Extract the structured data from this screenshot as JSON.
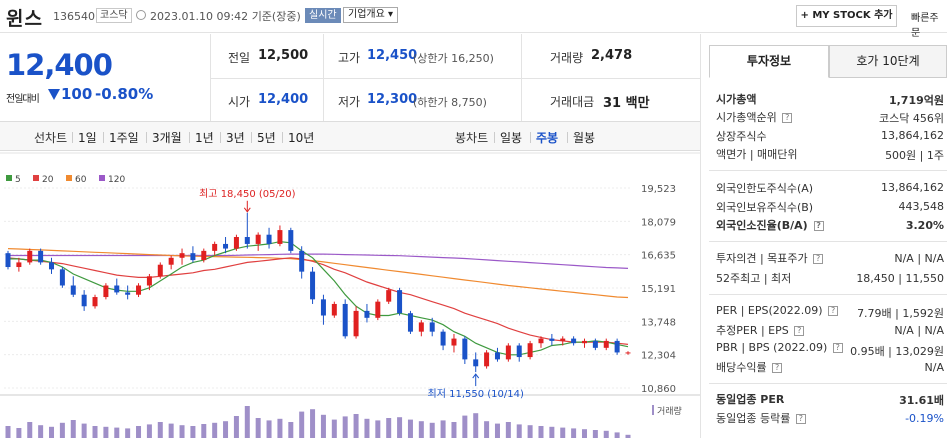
{
  "header": {
    "name": "윈스",
    "code": "136540",
    "market": "코스닥",
    "datetime": "2023.01.10 09:42",
    "basis": "기준(장중)",
    "realtime_badge": "실시간",
    "company_overview": "기업개요",
    "mystock_button": "+ MY STOCK 추가",
    "quick_order": "빠른주문"
  },
  "quote": {
    "price": "12,400",
    "change_label": "전일대비",
    "change": "100",
    "change_pct": "-0.80%"
  },
  "stats": {
    "prev_close_label": "전일",
    "prev_close": "12,500",
    "high_label": "고가",
    "high": "12,450",
    "upper_limit": "(상한가 16,250)",
    "volume_label": "거래량",
    "volume": "2,478",
    "open_label": "시가",
    "open": "12,400",
    "low_label": "저가",
    "low": "12,300",
    "lower_limit": "(하한가 8,750)",
    "amount_label": "거래대금",
    "amount": "31 백만"
  },
  "periods": {
    "line_label": "선차트",
    "items": [
      "1일",
      "1주일",
      "3개월",
      "1년",
      "3년",
      "5년",
      "10년"
    ],
    "candle_label": "봉차트",
    "candle_items": [
      "일봉",
      "주봉",
      "월봉"
    ],
    "candle_active": "주봉"
  },
  "chart_data": {
    "type": "candlestick",
    "ma_legend": [
      {
        "name": "5",
        "color": "#3f9a3f"
      },
      {
        "name": "20",
        "color": "#e04040"
      },
      {
        "name": "60",
        "color": "#f08a30"
      },
      {
        "name": "120",
        "color": "#9b59c8"
      }
    ],
    "y_ticks": [
      "19,523",
      "18,079",
      "16,635",
      "15,191",
      "13,748",
      "12,304",
      "10,860"
    ],
    "ylim": [
      10860,
      19523
    ],
    "high_annotation": "최고 18,450 (05/20)",
    "low_annotation": "최저 11,550 (10/14)",
    "volume_label": "거래량",
    "candles": [
      [
        16700,
        16800,
        16000,
        16100
      ],
      [
        16100,
        16500,
        15900,
        16300
      ],
      [
        16300,
        16900,
        16200,
        16800
      ],
      [
        16800,
        16900,
        16200,
        16300
      ],
      [
        16300,
        16500,
        15800,
        16000
      ],
      [
        16000,
        16100,
        15200,
        15300
      ],
      [
        15300,
        15700,
        14800,
        14900
      ],
      [
        14900,
        15100,
        14200,
        14400
      ],
      [
        14400,
        14900,
        14300,
        14800
      ],
      [
        14800,
        15400,
        14700,
        15300
      ],
      [
        15300,
        15600,
        14900,
        15000
      ],
      [
        15000,
        15300,
        14700,
        14900
      ],
      [
        14900,
        15400,
        14800,
        15300
      ],
      [
        15300,
        15800,
        15100,
        15700
      ],
      [
        15700,
        16300,
        15600,
        16200
      ],
      [
        16200,
        16600,
        16000,
        16500
      ],
      [
        16500,
        16900,
        16200,
        16700
      ],
      [
        16700,
        17000,
        16300,
        16400
      ],
      [
        16400,
        16900,
        16300,
        16800
      ],
      [
        16800,
        17200,
        16600,
        17100
      ],
      [
        17100,
        17400,
        16700,
        16900
      ],
      [
        16900,
        17500,
        16800,
        17400
      ],
      [
        17400,
        18450,
        16900,
        17100
      ],
      [
        17100,
        17600,
        16800,
        17500
      ],
      [
        17500,
        17800,
        16900,
        17100
      ],
      [
        17100,
        17900,
        17000,
        17700
      ],
      [
        17700,
        17800,
        16700,
        16800
      ],
      [
        16800,
        17000,
        15600,
        15900
      ],
      [
        15900,
        16100,
        14500,
        14700
      ],
      [
        14700,
        14900,
        13600,
        14000
      ],
      [
        14000,
        14600,
        13900,
        14500
      ],
      [
        14500,
        14700,
        13000,
        13100
      ],
      [
        13100,
        14400,
        13000,
        14200
      ],
      [
        14200,
        14500,
        13700,
        13900
      ],
      [
        13900,
        14700,
        13800,
        14600
      ],
      [
        14600,
        15200,
        14500,
        15100
      ],
      [
        15100,
        15200,
        14000,
        14100
      ],
      [
        14100,
        14200,
        13200,
        13300
      ],
      [
        13300,
        13800,
        13100,
        13700
      ],
      [
        13700,
        13900,
        13100,
        13300
      ],
      [
        13300,
        13400,
        12500,
        12700
      ],
      [
        12700,
        13200,
        12400,
        13000
      ],
      [
        13000,
        13100,
        11900,
        12100
      ],
      [
        12100,
        12400,
        11550,
        11800
      ],
      [
        11800,
        12500,
        11700,
        12400
      ],
      [
        12400,
        12600,
        12000,
        12100
      ],
      [
        12100,
        12800,
        12000,
        12700
      ],
      [
        12700,
        12800,
        12000,
        12200
      ],
      [
        12200,
        12900,
        12100,
        12800
      ],
      [
        12800,
        13100,
        12600,
        13000
      ],
      [
        13000,
        13200,
        12700,
        12900
      ],
      [
        12900,
        13100,
        12700,
        13000
      ],
      [
        13000,
        13100,
        12700,
        12800
      ],
      [
        12800,
        13000,
        12600,
        12900
      ],
      [
        12900,
        13000,
        12500,
        12600
      ],
      [
        12600,
        13000,
        12500,
        12900
      ],
      [
        12900,
        13000,
        12300,
        12400
      ],
      [
        12400,
        12450,
        12300,
        12400
      ]
    ],
    "volumes": [
      30,
      25,
      40,
      32,
      28,
      38,
      45,
      36,
      30,
      28,
      26,
      24,
      30,
      34,
      40,
      36,
      32,
      30,
      35,
      38,
      42,
      55,
      80,
      50,
      44,
      48,
      40,
      66,
      72,
      58,
      46,
      54,
      60,
      48,
      44,
      50,
      52,
      46,
      42,
      38,
      44,
      40,
      56,
      62,
      42,
      36,
      40,
      34,
      32,
      30,
      28,
      26,
      24,
      22,
      20,
      18,
      14,
      8
    ],
    "ma5": [
      16450,
      16450,
      16400,
      16400,
      16300,
      16100,
      15800,
      15600,
      15400,
      15200,
      15100,
      15050,
      15050,
      15200,
      15500,
      15800,
      16100,
      16300,
      16400,
      16600,
      16750,
      16900,
      17000,
      17050,
      17100,
      17200,
      17150,
      16800,
      16500,
      16000,
      15500,
      14900,
      14400,
      14100,
      14000,
      14000,
      14100,
      14000,
      13900,
      13800,
      13600,
      13300,
      13100,
      12800,
      12600,
      12400,
      12300,
      12300,
      12400,
      12500,
      12700,
      12750,
      12850,
      12850,
      12900,
      12850,
      12750,
      12650
    ],
    "ma20": [
      16500,
      16450,
      16400,
      16350,
      16300,
      16250,
      16150,
      16050,
      15950,
      15850,
      15750,
      15700,
      15650,
      15650,
      15700,
      15750,
      15800,
      15850,
      15950,
      16000,
      16100,
      16200,
      16300,
      16350,
      16400,
      16450,
      16500,
      16450,
      16350,
      16200,
      16000,
      15850,
      15650,
      15450,
      15300,
      15150,
      15000,
      14900,
      14750,
      14600,
      14450,
      14300,
      14100,
      13950,
      13800,
      13650,
      13450,
      13300,
      13150,
      13050,
      12950,
      12900,
      12850,
      12850,
      12850,
      12850,
      12800,
      12750
    ],
    "ma60": [
      16900,
      16880,
      16860,
      16840,
      16820,
      16800,
      16780,
      16760,
      16740,
      16720,
      16700,
      16680,
      16660,
      16640,
      16620,
      16600,
      16580,
      16570,
      16560,
      16550,
      16540,
      16530,
      16520,
      16510,
      16500,
      16480,
      16460,
      16420,
      16380,
      16320,
      16260,
      16200,
      16140,
      16080,
      16020,
      15960,
      15900,
      15840,
      15780,
      15720,
      15660,
      15600,
      15540,
      15480,
      15420,
      15360,
      15300,
      15250,
      15200,
      15150,
      15100,
      15050,
      15000,
      14950,
      14900,
      14850,
      14800,
      14780
    ],
    "ma120": [
      16600,
      16600,
      16600,
      16600,
      16600,
      16600,
      16600,
      16600,
      16600,
      16600,
      16600,
      16600,
      16600,
      16600,
      16600,
      16600,
      16600,
      16600,
      16600,
      16600,
      16600,
      16610,
      16620,
      16630,
      16640,
      16650,
      16660,
      16660,
      16660,
      16660,
      16650,
      16640,
      16630,
      16620,
      16610,
      16600,
      16590,
      16570,
      16550,
      16530,
      16510,
      16490,
      16470,
      16440,
      16410,
      16380,
      16350,
      16320,
      16290,
      16260,
      16230,
      16200,
      16170,
      16140,
      16110,
      16080,
      16060,
      16040
    ]
  },
  "info": {
    "tab_active": "투자정보",
    "tab_other": "호가 10단계",
    "rows": {
      "market_cap_label": "시가총액",
      "market_cap": "1,719억원",
      "market_rank_label": "시가총액순위",
      "market_rank": "코스닥 456위",
      "shares_label": "상장주식수",
      "shares": "13,864,162",
      "par_label": "액면가 | 매매단위",
      "par": "500원 | 1주",
      "foreign_limit_label": "외국인한도주식수(A)",
      "foreign_limit": "13,864,162",
      "foreign_hold_label": "외국인보유주식수(B)",
      "foreign_hold": "443,548",
      "foreign_ratio_label": "외국인소진율(B/A)",
      "foreign_ratio": "3.20%",
      "opinion_label": "투자의견 | 목표주가",
      "opinion": "N/A | N/A",
      "w52_label": "52주최고 | 최저",
      "w52": "18,450 | 11,550",
      "per_label": "PER | EPS(2022.09)",
      "per": "7.79배 | 1,592원",
      "est_per_label": "추정PER | EPS",
      "est_per": "N/A | N/A",
      "pbr_label": "PBR | BPS (2022.09)",
      "pbr": "0.95배 | 13,029원",
      "div_label": "배당수익률",
      "div": "N/A",
      "sector_per_label": "동일업종 PER",
      "sector_per": "31.61배",
      "sector_rate_label": "동일업종 등락률",
      "sector_rate": "-0.19%"
    }
  }
}
